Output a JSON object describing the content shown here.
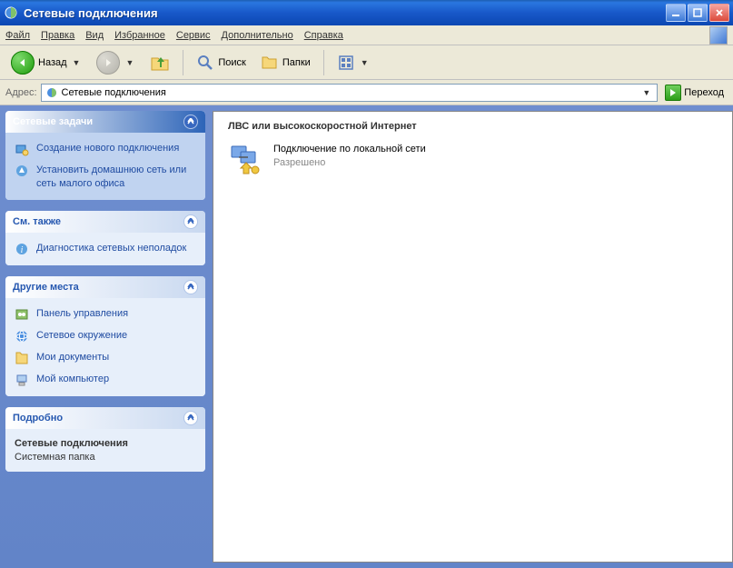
{
  "window": {
    "title": "Сетевые подключения"
  },
  "menu": {
    "file": "Файл",
    "edit": "Правка",
    "view": "Вид",
    "favorites": "Избранное",
    "tools": "Сервис",
    "advanced": "Дополнительно",
    "help": "Справка"
  },
  "toolbar": {
    "back": "Назад",
    "search": "Поиск",
    "folders": "Папки"
  },
  "address": {
    "label": "Адрес:",
    "value": "Сетевые подключения",
    "go": "Переход"
  },
  "sidebar": {
    "tasks": {
      "title": "Сетевые задачи",
      "items": [
        "Создание нового подключения",
        "Установить домашнюю сеть или сеть малого офиса"
      ]
    },
    "seealso": {
      "title": "См. также",
      "items": [
        "Диагностика сетевых неполадок"
      ]
    },
    "places": {
      "title": "Другие места",
      "items": [
        "Панель управления",
        "Сетевое окружение",
        "Мои документы",
        "Мой компьютер"
      ]
    },
    "details": {
      "title": "Подробно",
      "name": "Сетевые подключения",
      "type": "Системная папка"
    }
  },
  "content": {
    "group": "ЛВС или высокоскоростной Интернет",
    "connection": {
      "name": "Подключение по локальной сети",
      "status": "Разрешено"
    }
  }
}
